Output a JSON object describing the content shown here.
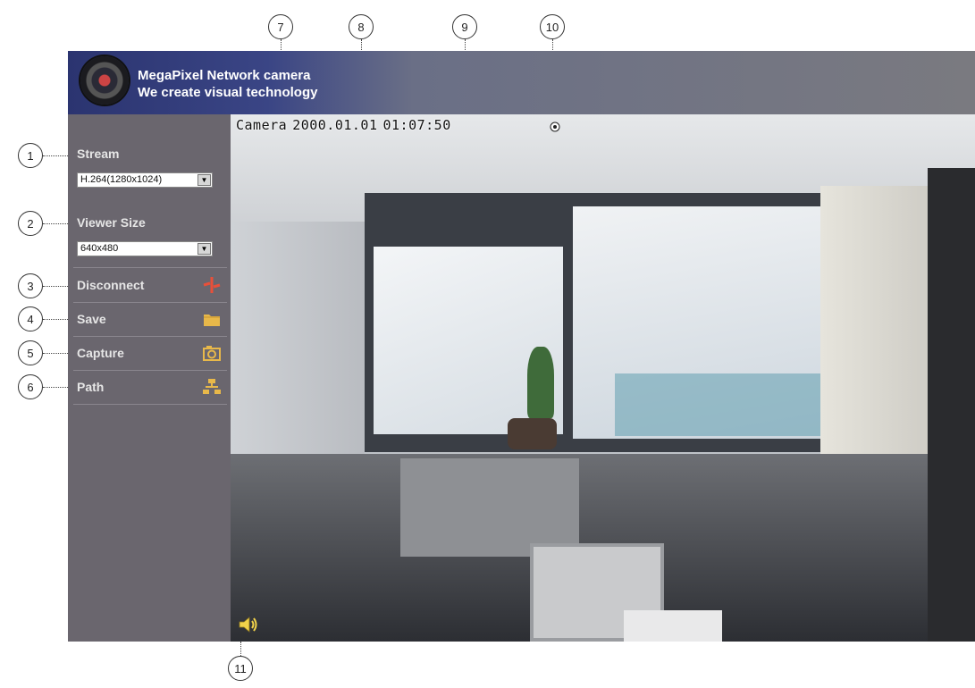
{
  "header": {
    "brand_line1": "MegaPixel Network camera",
    "brand_line2": "We create visual technology"
  },
  "sidebar": {
    "stream": {
      "label": "Stream",
      "value": "H.264(1280x1024)"
    },
    "viewer_size": {
      "label": "Viewer Size",
      "value": "640x480"
    },
    "menu": [
      {
        "label": "Disconnect",
        "icon": "disconnect-icon"
      },
      {
        "label": "Save",
        "icon": "folder-icon"
      },
      {
        "label": "Capture",
        "icon": "camera-icon"
      },
      {
        "label": "Path",
        "icon": "network-path-icon"
      }
    ]
  },
  "video": {
    "osd_name": "Camera",
    "osd_date": "2000.01.01",
    "osd_time": "01:07:50",
    "settings_icon": "gear-icon",
    "audio_icon": "speaker-icon"
  },
  "callouts": [
    "1",
    "2",
    "3",
    "4",
    "5",
    "6",
    "7",
    "8",
    "9",
    "10",
    "11"
  ],
  "colors": {
    "sidebar_bg": "#6a666e",
    "disconnect_icon": "#e8503a",
    "folder_icon": "#e8b84a"
  }
}
